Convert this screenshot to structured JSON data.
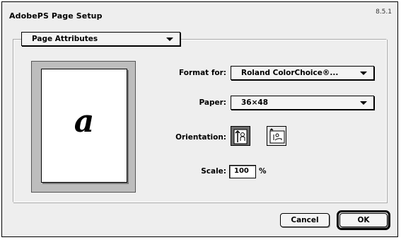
{
  "dialog": {
    "title": "AdobePS Page Setup",
    "version": "8.5.1"
  },
  "section_popup": {
    "selected": "Page Attributes"
  },
  "format_for": {
    "label": "Format for:",
    "selected": "Roland ColorChoice®..."
  },
  "paper": {
    "label": "Paper:",
    "selected": "36×48"
  },
  "preview": {
    "letter": "a"
  },
  "orientation": {
    "label": "Orientation:",
    "options": [
      {
        "name": "portrait",
        "icon": "portrait-orientation-icon",
        "selected": true
      },
      {
        "name": "landscape",
        "icon": "landscape-orientation-icon",
        "selected": false
      }
    ]
  },
  "scale": {
    "label": "Scale:",
    "value": "100",
    "unit": "%"
  },
  "buttons": {
    "cancel": "Cancel",
    "ok": "OK"
  }
}
